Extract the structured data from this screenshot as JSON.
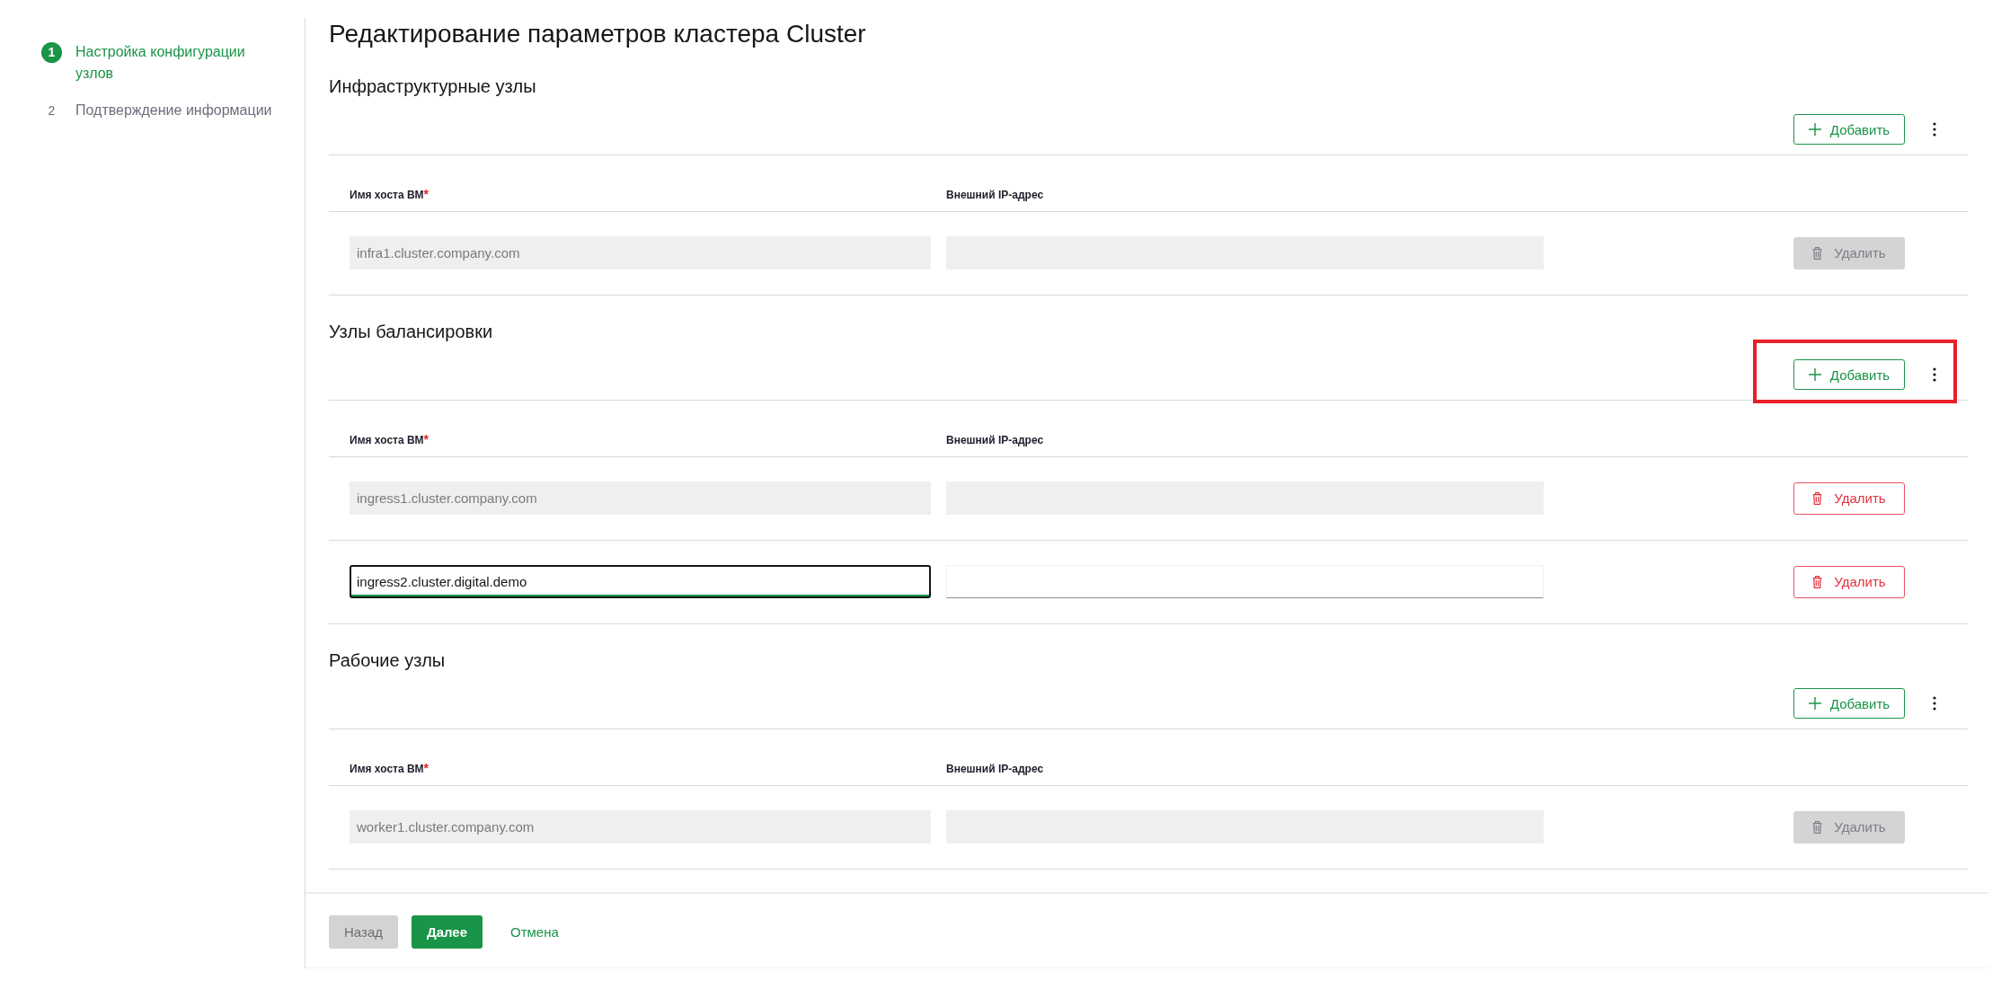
{
  "steps": [
    {
      "number": "1",
      "label": "Настройка конфигурации узлов",
      "selected": true
    },
    {
      "number": "2",
      "label": "Подтверждение информации",
      "selected": false
    }
  ],
  "title": "Редактирование параметров кластера Cluster",
  "sections": [
    {
      "heading": "Инфраструктурные узлы",
      "add_button": "Добавить",
      "highlighted": false,
      "columns": [
        {
          "label": "Имя хоста ВМ",
          "required_mark": "*"
        },
        {
          "label": "Внешний IP-адрес"
        }
      ],
      "rows": [
        {
          "host": {
            "value": "infra1.cluster.company.com",
            "readonly": true,
            "focused": false
          },
          "ip": {
            "readonly": true,
            "focused": false
          },
          "delete": {
            "label": "Удалить",
            "disabled": true
          }
        }
      ]
    },
    {
      "heading": "Узлы балансировки",
      "add_button": "Добавить",
      "highlighted": true,
      "columns": [
        {
          "label": "Имя хоста ВМ",
          "required_mark": "*"
        },
        {
          "label": "Внешний IP-адрес"
        }
      ],
      "rows": [
        {
          "host": {
            "value": "ingress1.cluster.company.com",
            "readonly": true,
            "focused": false
          },
          "ip": {
            "readonly": true,
            "focused": false
          },
          "delete": {
            "label": "Удалить",
            "disabled": false
          }
        },
        {
          "host": {
            "value": "ingress2.cluster.digital.demo",
            "readonly": false,
            "focused": true
          },
          "ip": {
            "readonly": false,
            "focused": false
          },
          "delete": {
            "label": "Удалить",
            "disabled": false
          }
        }
      ]
    },
    {
      "heading": "Рабочие узлы",
      "add_button": "Добавить",
      "highlighted": false,
      "columns": [
        {
          "label": "Имя хоста ВМ",
          "required_mark": "*"
        },
        {
          "label": "Внешний IP-адрес"
        }
      ],
      "rows": [
        {
          "host": {
            "value": "worker1.cluster.company.com",
            "readonly": true,
            "focused": false
          },
          "ip": {
            "readonly": true,
            "focused": false
          },
          "delete": {
            "label": "Удалить",
            "disabled": true
          }
        }
      ]
    }
  ],
  "footer_buttons": [
    {
      "label": "Назад",
      "kind": "secondary",
      "disabled": true
    },
    {
      "label": "Далее",
      "kind": "primary",
      "disabled": false
    },
    {
      "label": "Отмена",
      "kind": "link",
      "disabled": false
    }
  ]
}
